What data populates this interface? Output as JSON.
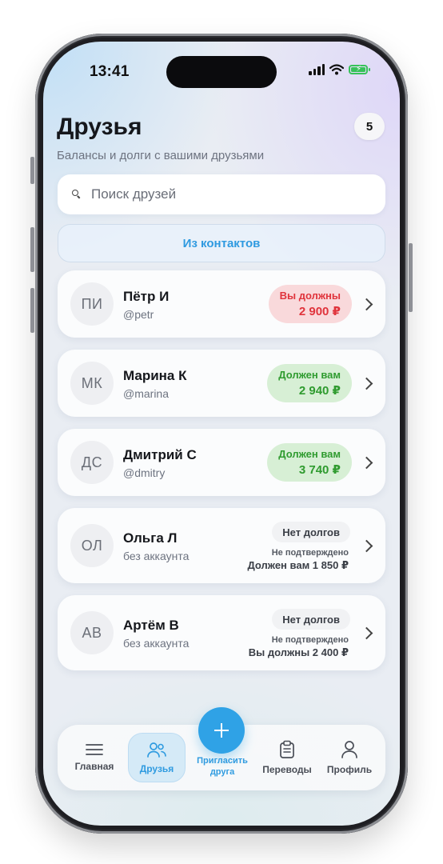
{
  "status": {
    "time": "13:41"
  },
  "header": {
    "title": "Друзья",
    "count": "5",
    "subtitle": "Балансы и долги с вашими друзьями"
  },
  "search": {
    "placeholder": "Поиск друзей",
    "value": ""
  },
  "contacts_button": "Из контактов",
  "friends": [
    {
      "initials": "ПИ",
      "name": "Пётр И",
      "handle": "@petr",
      "status": "Вы должны",
      "amount": "2 900 ₽",
      "kind": "owe"
    },
    {
      "initials": "МК",
      "name": "Марина К",
      "handle": "@marina",
      "status": "Должен вам",
      "amount": "2 940 ₽",
      "kind": "owed"
    },
    {
      "initials": "ДС",
      "name": "Дмитрий С",
      "handle": "@dmitry",
      "status": "Должен вам",
      "amount": "3 740 ₽",
      "kind": "owed"
    },
    {
      "initials": "ОЛ",
      "name": "Ольга Л",
      "handle": "без аккаунта",
      "status": "Нет долгов",
      "unconfirmed": "Не подтверждено",
      "note": "Должен вам 1 850 ₽",
      "kind": "none"
    },
    {
      "initials": "АВ",
      "name": "Артём В",
      "handle": "без аккаунта",
      "status": "Нет долгов",
      "unconfirmed": "Не подтверждено",
      "note": "Вы должны 2 400 ₽",
      "kind": "none"
    }
  ],
  "nav": {
    "home": "Главная",
    "friends": "Друзья",
    "invite": "Пригласить друга",
    "transfers": "Переводы",
    "profile": "Профиль"
  },
  "colors": {
    "accent": "#2fa2e6",
    "debt_red": "#e0343c",
    "credit_green": "#2f9b2f"
  }
}
